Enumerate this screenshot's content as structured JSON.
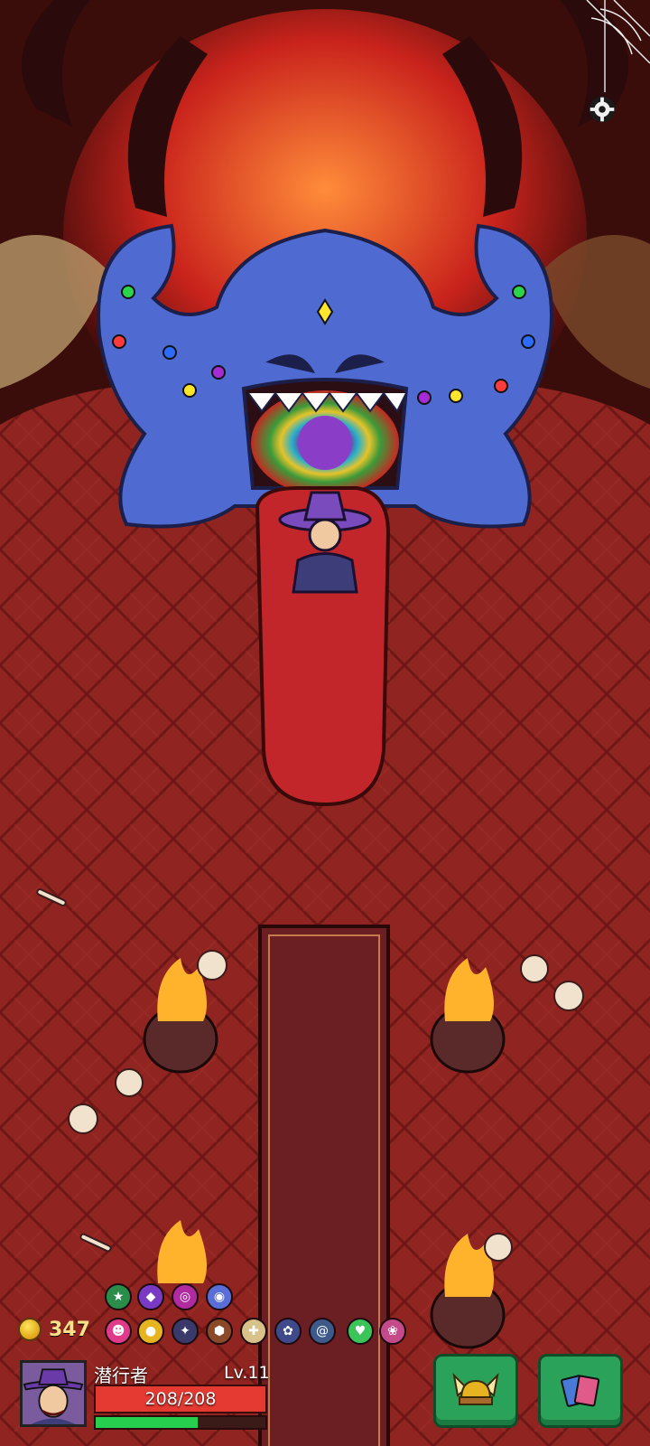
{
  "player": {
    "gold": "347",
    "name": "潜行者",
    "level": "Lv.11",
    "hp_text": "208/208",
    "xp_fraction": 0.6
  },
  "icons": {
    "settings": "gear-icon",
    "hud_buttons": [
      "helmet-icon",
      "cards-icon"
    ],
    "relics_row1": [
      "green-star-triangle-icon",
      "purple-shield-badge-icon",
      "fire-ring-icon",
      "blue-swirl-icon"
    ],
    "relics_row2": [
      "pink-demon-icon",
      "gold-coin-icon",
      "claw-icon",
      "brown-gem-icon",
      "bone-icon",
      "paw-badge-icon",
      "spiral-badge-icon",
      "green-potion-icon",
      "pink-flower-icon"
    ]
  },
  "colors": {
    "hp": "#e53a32",
    "xp": "#27cf4f",
    "button": "#2aa25a",
    "floor": "#8e2420",
    "boss": "#4f6bd1"
  }
}
